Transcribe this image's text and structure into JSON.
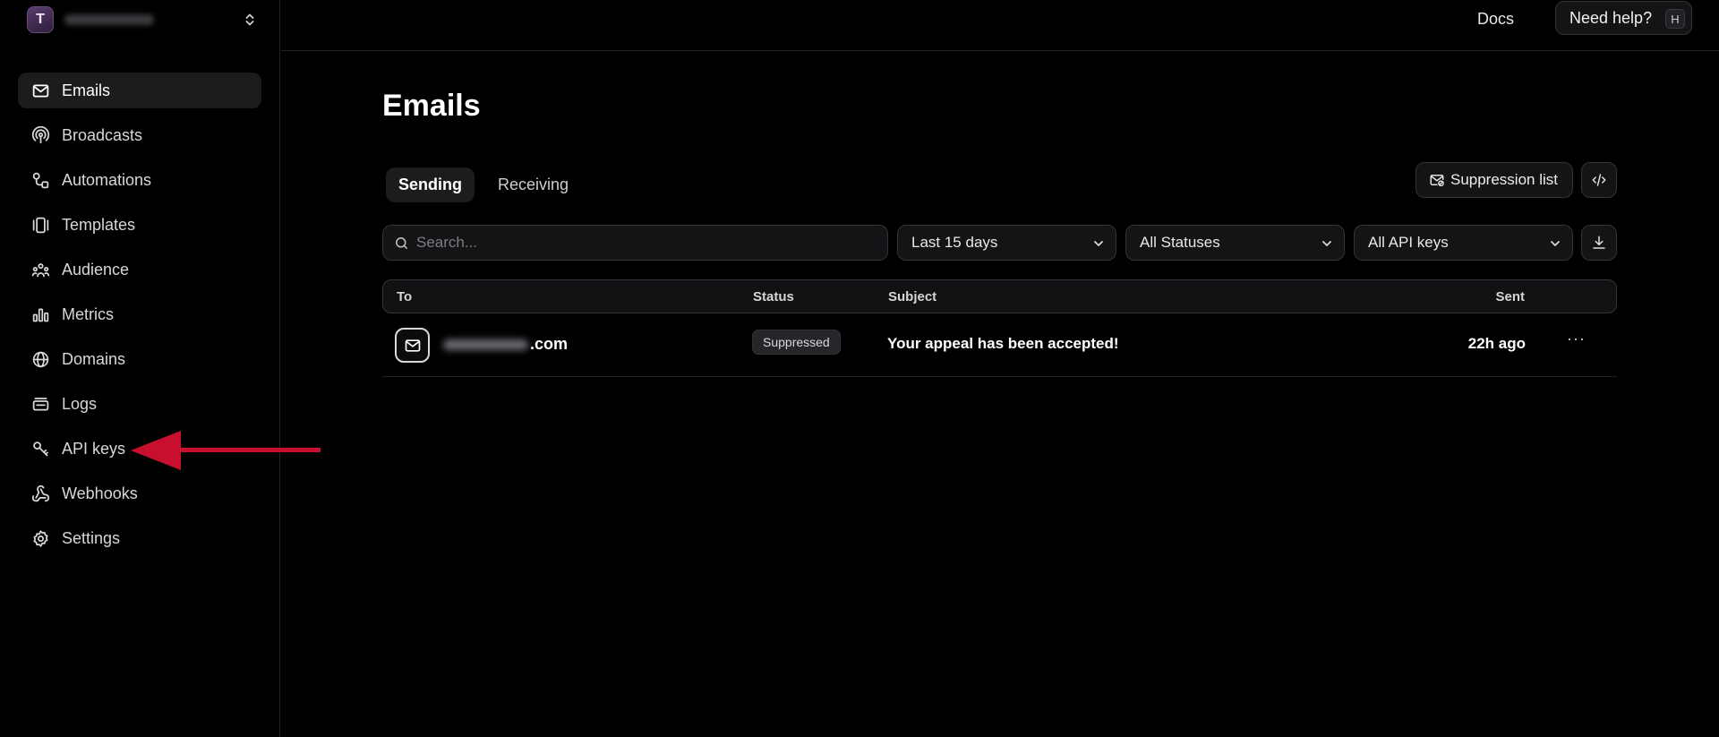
{
  "team": {
    "initial": "T"
  },
  "sidebar": {
    "items": [
      {
        "label": "Emails",
        "icon": "mail-icon",
        "active": true
      },
      {
        "label": "Broadcasts",
        "icon": "broadcast-icon"
      },
      {
        "label": "Automations",
        "icon": "automation-icon"
      },
      {
        "label": "Templates",
        "icon": "templates-icon"
      },
      {
        "label": "Audience",
        "icon": "audience-icon"
      },
      {
        "label": "Metrics",
        "icon": "metrics-icon"
      },
      {
        "label": "Domains",
        "icon": "globe-icon"
      },
      {
        "label": "Logs",
        "icon": "logs-icon"
      },
      {
        "label": "API keys",
        "icon": "key-icon"
      },
      {
        "label": "Webhooks",
        "icon": "webhook-icon"
      },
      {
        "label": "Settings",
        "icon": "gear-icon"
      }
    ]
  },
  "topbar": {
    "docs": "Docs",
    "help": "Need help?",
    "help_shortcut": "H"
  },
  "page": {
    "title": "Emails",
    "tabs": [
      {
        "label": "Sending",
        "active": true
      },
      {
        "label": "Receiving"
      }
    ],
    "suppression_label": "Suppression list"
  },
  "filters": {
    "search_placeholder": "Search...",
    "date": "Last 15 days",
    "status": "All Statuses",
    "api_key": "All API keys"
  },
  "table": {
    "columns": {
      "to": "To",
      "status": "Status",
      "subject": "Subject",
      "sent": "Sent"
    },
    "rows": [
      {
        "to_domain": ".com",
        "status": "Suppressed",
        "subject": "Your appeal has been accepted!",
        "sent": "22h ago",
        "actions": "···"
      }
    ]
  },
  "colors": {
    "background": "#000000",
    "annotation_arrow": "#c8102e"
  }
}
